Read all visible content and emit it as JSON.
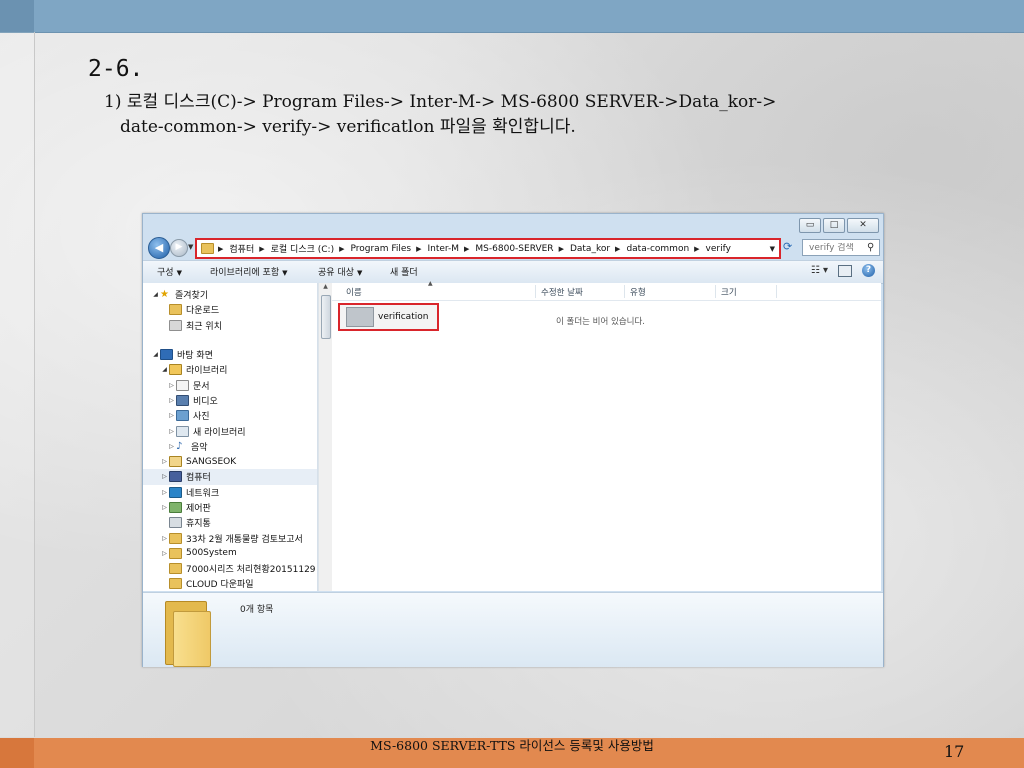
{
  "slide": {
    "heading": "2-6.",
    "line1": "1) 로컬 디스크(C)-> Program Files-> Inter-M-> MS-6800 SERVER->Data_kor->",
    "line2": "date-common-> verify-> verificatlon 파일을 확인합니다.",
    "footer": "MS-6800 SERVER-TTS 라이선스 등록및 사용방법",
    "page_number": "17"
  },
  "colors": {
    "top_band": "#7fa6c4",
    "footer_band": "#e2894f",
    "highlight": "#d9252b"
  },
  "explorer": {
    "window_controls": [
      "minimize-icon",
      "maximize-icon",
      "close-icon"
    ],
    "breadcrumbs": [
      "컴퓨터",
      "로컬 디스크 (C:)",
      "Program Files",
      "Inter-M",
      "MS-6800-SERVER",
      "Data_kor",
      "data-common",
      "verify"
    ],
    "search_placeholder": "verify 검색",
    "toolbar": {
      "organize": "구성",
      "include_in_library": "라이브러리에 포함",
      "share_with": "공유 대상",
      "new_folder": "새 폴더"
    },
    "nav_tree": [
      {
        "label": "즐겨찾기",
        "icon": "star-icon"
      },
      {
        "label": "다운로드",
        "icon": "downloads-folder-icon"
      },
      {
        "label": "최근 위치",
        "icon": "recent-places-icon"
      },
      {
        "label": "바탕 화면",
        "icon": "desktop-icon"
      },
      {
        "label": "라이브러리",
        "icon": "library-icon"
      },
      {
        "label": "문서",
        "icon": "documents-icon"
      },
      {
        "label": "비디오",
        "icon": "videos-icon"
      },
      {
        "label": "사진",
        "icon": "pictures-icon"
      },
      {
        "label": "새 라이브러리",
        "icon": "new-library-icon"
      },
      {
        "label": "음악",
        "icon": "music-icon"
      },
      {
        "label": "SANGSEOK",
        "icon": "user-folder-icon"
      },
      {
        "label": "컴퓨터",
        "icon": "computer-icon"
      },
      {
        "label": "네트워크",
        "icon": "network-icon"
      },
      {
        "label": "제어판",
        "icon": "control-panel-icon"
      },
      {
        "label": "휴지통",
        "icon": "recycle-bin-icon"
      },
      {
        "label": "33차 2월 개통물량 검토보고서",
        "icon": "folder-icon"
      },
      {
        "label": "500System",
        "icon": "folder-icon"
      },
      {
        "label": "7000시리즈 처리현황20151129",
        "icon": "folder-icon"
      },
      {
        "label": "CLOUD 다운파일",
        "icon": "folder-icon"
      }
    ],
    "columns": {
      "name": "이름",
      "modified": "수정한 날짜",
      "type": "유형",
      "size": "크기"
    },
    "file_name": "verification",
    "empty_message": "이 폴더는 비어 있습니다.",
    "item_count": "0개 항목"
  }
}
